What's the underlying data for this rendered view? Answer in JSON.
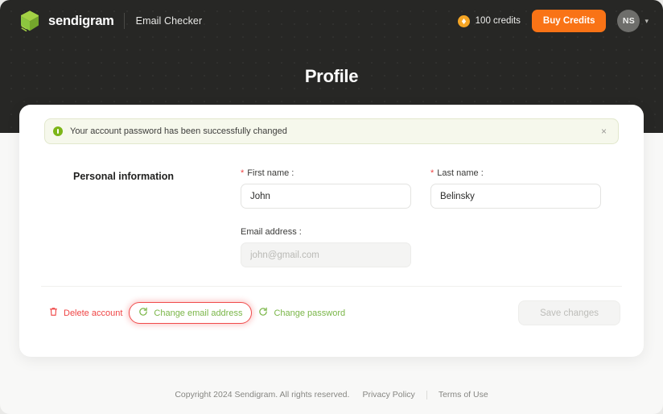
{
  "topbar": {
    "logo_icon": "sendigram-cube-icon",
    "brand_name": "sendigram",
    "app_name": "Email Checker",
    "coin_icon": "coin-icon",
    "credits_label": "100 credits",
    "buy_credits_label": "Buy Credits",
    "avatar_initials": "NS",
    "chevron_icon": "chevron-down-icon",
    "chevron_glyph": "▾"
  },
  "page": {
    "title": "Profile"
  },
  "alert": {
    "icon": "info-circle-icon",
    "message": "Your account password has been successfully changed",
    "close_glyph": "×",
    "bg_color": "#f6f8ec",
    "accent_color": "#7cb518"
  },
  "form": {
    "section_title": "Personal information",
    "required_marker": "*",
    "fields": [
      {
        "label": "First name :",
        "value": "John",
        "placeholder": "",
        "required": true,
        "disabled": false
      },
      {
        "label": "Last name :",
        "value": "Belinsky",
        "placeholder": "",
        "required": true,
        "disabled": false
      },
      {
        "label": "Email address :",
        "value": "",
        "placeholder": "john@gmail.com",
        "required": false,
        "disabled": true
      }
    ]
  },
  "actions": {
    "delete_account": {
      "label": "Delete account",
      "icon": "trash-icon",
      "color": "#ef4444"
    },
    "change_email": {
      "label": "Change email address",
      "icon": "refresh-icon",
      "color": "#7ab648",
      "highlight_color": "#f04a4a"
    },
    "change_password": {
      "label": "Change password",
      "icon": "refresh-icon",
      "color": "#7ab648"
    },
    "save_label": "Save changes"
  },
  "footer": {
    "copyright": "Copyright 2024 Sendigram. All rights reserved.",
    "privacy_policy": "Privacy Policy",
    "terms_of_use": "Terms of Use"
  }
}
